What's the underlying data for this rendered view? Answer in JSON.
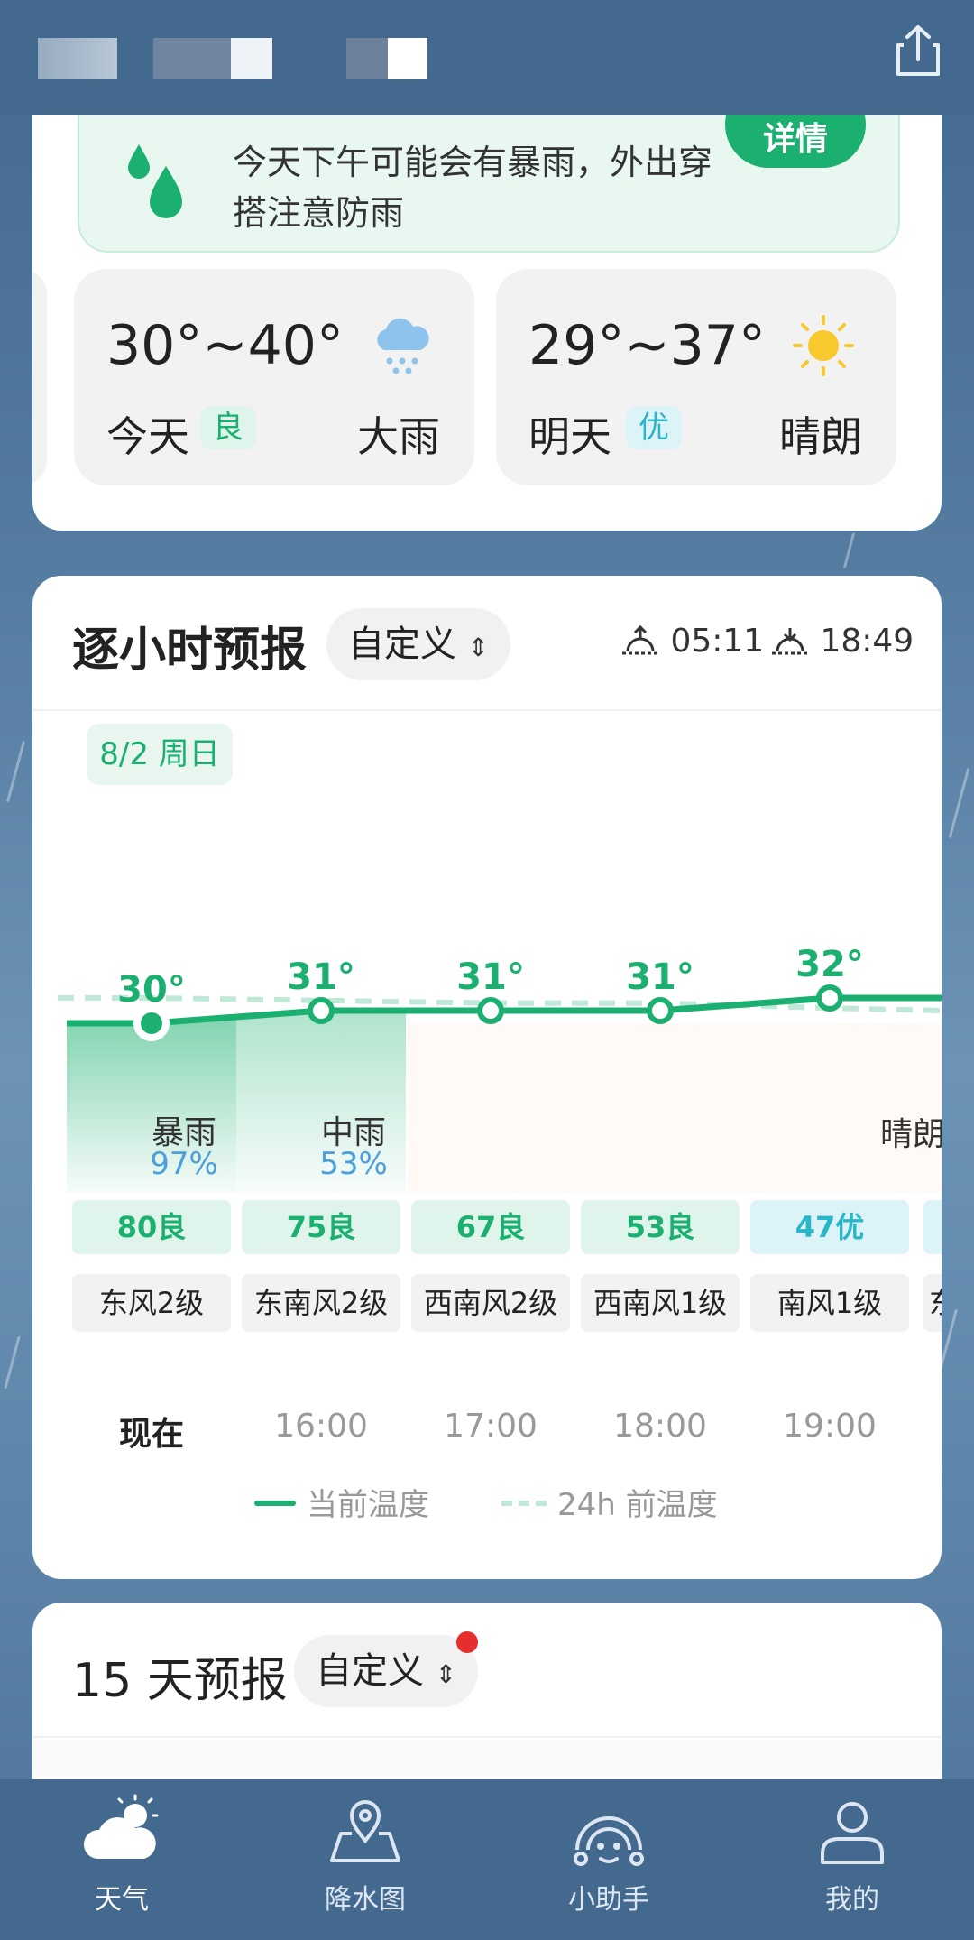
{
  "alert": {
    "text": "今天下午可能会有暴雨，外出穿搭注意防雨",
    "detail_button": "详情"
  },
  "days": [
    {
      "temp": "30°~40°",
      "label": "今天",
      "aqi": "良",
      "condition": "大雨",
      "icon": "rain-cloud-icon"
    },
    {
      "temp": "29°~37°",
      "label": "明天",
      "aqi": "优",
      "condition": "晴朗",
      "icon": "sun-icon"
    }
  ],
  "hourly": {
    "title": "逐小时预报",
    "custom": "自定义",
    "sunrise": "05:11",
    "sunset": "18:49",
    "date": "8/2 周日",
    "temps": [
      "30°",
      "31°",
      "31°",
      "31°",
      "32°"
    ],
    "prev_temps": [
      32,
      31.8,
      31.6,
      31.6,
      31.2
    ],
    "conditions": [
      {
        "text": "暴雨",
        "precip": "97%"
      },
      {
        "text": "中雨",
        "precip": "53%"
      },
      {
        "text": "晴朗",
        "precip": ""
      }
    ],
    "aqi": [
      "80良",
      "75良",
      "67良",
      "53良",
      "47优"
    ],
    "wind": [
      "东风2级",
      "东南风2级",
      "西南风2级",
      "西南风1级",
      "南风1级",
      "东"
    ],
    "times": [
      "现在",
      "16:00",
      "17:00",
      "18:00",
      "19:00"
    ],
    "legend_current": "当前温度",
    "legend_prev": "24h 前温度"
  },
  "fifteen": {
    "title": "15 天预报",
    "custom": "自定义"
  },
  "nav": [
    {
      "label": "天气",
      "icon": "weather-icon",
      "active": true
    },
    {
      "label": "降水图",
      "icon": "map-pin-icon",
      "active": false
    },
    {
      "label": "小助手",
      "icon": "assistant-icon",
      "active": false
    },
    {
      "label": "我的",
      "icon": "user-icon",
      "active": false
    }
  ],
  "colors": {
    "accent": "#1bb070",
    "aqi_good_bg": "#dff4ea",
    "aqi_excellent_bg": "#dcf3f7",
    "nav_bg": "#44698f"
  }
}
